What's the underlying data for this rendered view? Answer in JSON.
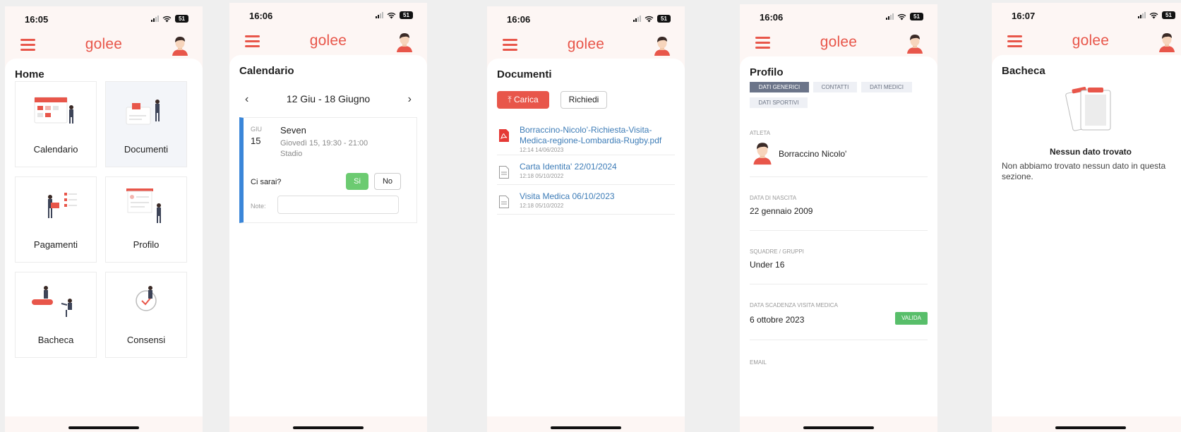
{
  "screens": {
    "home": {
      "time": "16:05",
      "battery": "51",
      "logo": "golee",
      "title": "Home",
      "tiles": [
        "Calendario",
        "Documenti",
        "Pagamenti",
        "Profilo",
        "Bacheca",
        "Consensi"
      ]
    },
    "calendario": {
      "time": "16:06",
      "battery": "51",
      "logo": "golee",
      "title": "Calendario",
      "week_label": "12 Giu - 18 Giugno",
      "prev": "‹",
      "next": "›",
      "event": {
        "month": "GIU",
        "day": "15",
        "title": "Seven",
        "when": "Giovedì 15, 19:30 - 21:00",
        "where": "Stadio",
        "question": "Ci sarai?",
        "yes": "Si",
        "no": "No",
        "note_label": "Note:"
      }
    },
    "documenti": {
      "time": "16:06",
      "battery": "51",
      "logo": "golee",
      "title": "Documenti",
      "upload_label": "Carica",
      "request_label": "Richiedi",
      "docs": [
        {
          "name": "Borraccino-Nicolo'-Richiesta-Visita-Medica-regione-Lombardia-Rugby.pdf",
          "date": "12:14 14/06/2023",
          "icon": "pdf-icon"
        },
        {
          "name": "Carta Identita' 22/01/2024",
          "date": "12:18 05/10/2022",
          "icon": "document-icon"
        },
        {
          "name": "Visita Medica 06/10/2023",
          "date": "12:18 05/10/2022",
          "icon": "document-icon"
        }
      ]
    },
    "profilo": {
      "time": "16:06",
      "battery": "51",
      "logo": "golee",
      "title": "Profilo",
      "tabs": [
        "DATI GENERICI",
        "CONTATTI",
        "DATI MEDICI",
        "DATI SPORTIVI"
      ],
      "athlete_label": "ATLETA",
      "athlete_name": "Borraccino Nicolo'",
      "birth_label": "DATA DI NASCITA",
      "birth_value": "22 gennaio 2009",
      "teams_label": "SQUADRE / GRUPPI",
      "teams_value": "Under 16",
      "visit_label": "DATA SCADENZA VISITA MEDICA",
      "visit_value": "6 ottobre 2023",
      "visit_badge": "VALIDA",
      "email_label": "EMAIL"
    },
    "bacheca": {
      "time": "16:07",
      "battery": "51",
      "logo": "golee",
      "title": "Bacheca",
      "empty_title": "Nessun dato trovato",
      "empty_desc": "Non abbiamo trovato nessun dato in questa sezione."
    }
  },
  "colors": {
    "brand": "#e8564a",
    "link": "#3d7cb7",
    "event_accent": "#3a86d9",
    "success": "#58be6a"
  }
}
